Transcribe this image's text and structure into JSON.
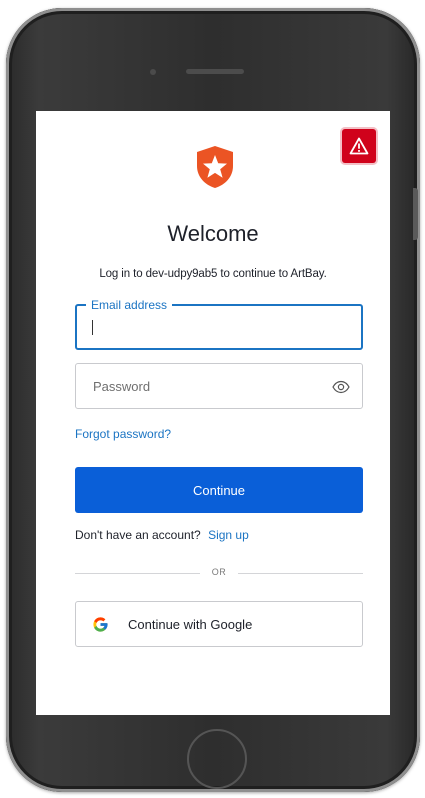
{
  "alert": {
    "icon": "warning-triangle-icon",
    "color": "#d0021b"
  },
  "logo": {
    "icon": "auth0-shield-star-logo",
    "color": "#eb5424"
  },
  "header": {
    "title": "Welcome",
    "subtitle": "Log in to dev-udpy9ab5 to continue to ArtBay."
  },
  "form": {
    "email_label": "Email address",
    "email_value": "",
    "password_placeholder": "Password",
    "password_toggle_icon": "eye-icon",
    "forgot_password": "Forgot password?",
    "continue_label": "Continue"
  },
  "signup": {
    "prompt": "Don't have an account?",
    "link": "Sign up"
  },
  "divider": {
    "text": "OR"
  },
  "social": {
    "google_label": "Continue with Google",
    "google_icon": "google-g-icon"
  },
  "colors": {
    "primary": "#0a5fd8",
    "link": "#1b74c3",
    "alert": "#d0021b"
  }
}
